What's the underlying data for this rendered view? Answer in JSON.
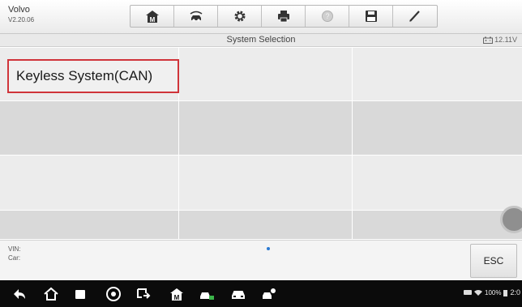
{
  "app": {
    "make": "Volvo",
    "version": "V2.20.06"
  },
  "toolbar": {
    "buttons": [
      {
        "name": "home",
        "icon": "home-m-icon"
      },
      {
        "name": "vehicle-swap",
        "icon": "car-swap-icon"
      },
      {
        "name": "settings",
        "icon": "gear-icon"
      },
      {
        "name": "print",
        "icon": "printer-icon"
      },
      {
        "name": "help",
        "icon": "help-icon"
      },
      {
        "name": "save",
        "icon": "save-icon"
      },
      {
        "name": "edit",
        "icon": "pen-icon"
      }
    ]
  },
  "titlebar": {
    "title": "System Selection",
    "voltage": "12.11V"
  },
  "systems": [
    {
      "label": "Keyless System(CAN)",
      "selected": true
    }
  ],
  "info": {
    "vin_label": "VIN:",
    "car_label": "Car:"
  },
  "esc_label": "ESC",
  "navbar": {
    "icons": [
      "back-icon",
      "home-icon",
      "recent-apps-icon",
      "chrome-icon",
      "screen-switch-icon",
      "home-m-icon",
      "car-diagnostic-icon",
      "car-icon",
      "car-service-icon"
    ],
    "battery": "100%",
    "time": "2:0"
  },
  "colors": {
    "selection_border": "#d0343a",
    "navbar": "#0b0b0b",
    "accent": "#2a7ad2"
  }
}
